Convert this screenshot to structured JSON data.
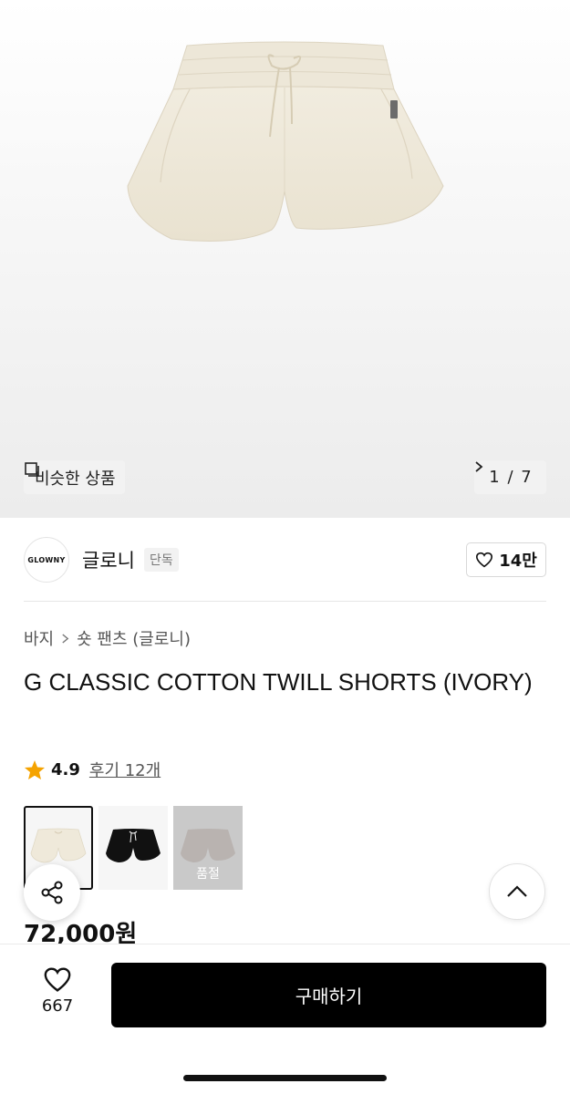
{
  "gallery": {
    "similar_label": "비슷한 상품",
    "current_page": "1",
    "separator": "/",
    "total_pages": "7"
  },
  "brand": {
    "logo_text": "GLOWNY",
    "name": "글로니",
    "tag": "단독",
    "favorite_count": "14만"
  },
  "breadcrumb": {
    "category": "바지",
    "subcategory": "숏 팬츠 (글로니)"
  },
  "product": {
    "title": "G CLASSIC COTTON TWILL SHORTS (IVORY)",
    "rating": "4.9",
    "reviews_label": "후기 12개",
    "price": "72,000원"
  },
  "swatches": [
    {
      "color": "ivory",
      "selected": true
    },
    {
      "color": "black",
      "selected": false
    },
    {
      "color": "grey",
      "selected": false,
      "soldout_label": "품절"
    }
  ],
  "bottom_bar": {
    "like_count": "667",
    "buy_label": "구매하기"
  },
  "colors": {
    "accent": "#000000",
    "star": "#f5a300",
    "shorts_ivory": "#efe9da"
  }
}
